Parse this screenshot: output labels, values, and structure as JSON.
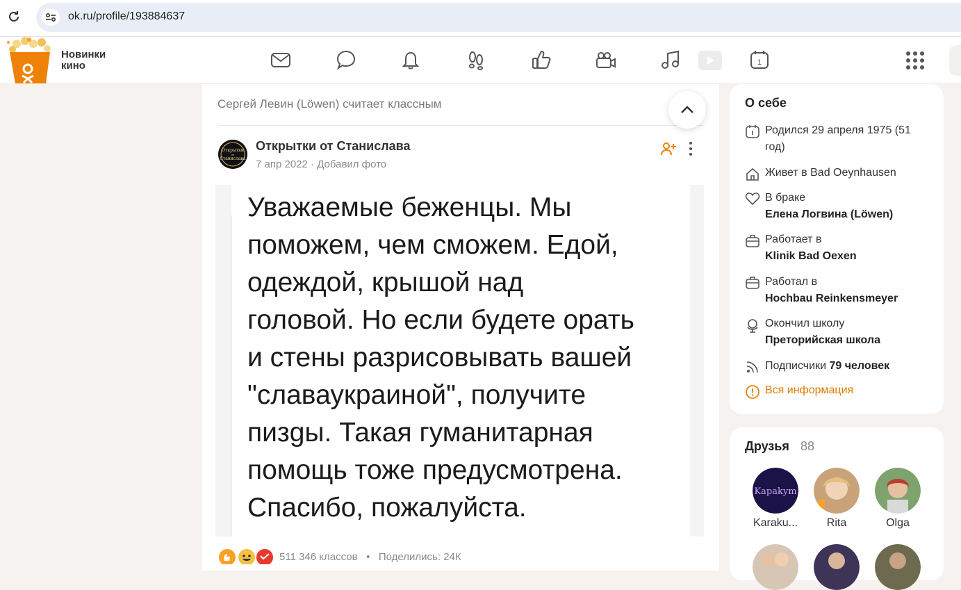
{
  "browser": {
    "url": "ok.ru/profile/193884637",
    "reload_icon": "reload-icon",
    "site_info_icon": "site-settings-icon"
  },
  "toolbar": {
    "promo_line1": "Новинки",
    "promo_line2": "кино",
    "icons": [
      "mail-icon",
      "chat-icon",
      "bell-icon",
      "footprints-icon",
      "thumbs-up-icon",
      "video-camera-icon",
      "music-icon",
      "play-icon",
      "calendar-icon",
      "apps-grid-icon"
    ],
    "calendar_day": "1"
  },
  "feed": {
    "header": "Сергей Левин (Löwen) считает классным",
    "group_name": "Открытки от Станислава",
    "avatar_text": "Открытки от Станислава",
    "post_date": "7 апр 2022",
    "post_action": "Добавил фото",
    "post_meta_sep": "·",
    "post_text": "Уважаемые беженцы. Мы\nпоможем, чем сможем. Едой,\nодеждой, крышой   над\nголовой. Но если будете орать\nи стены разрисовывать вашей\n\"славаукраиной\", получите\nпизgы. Такая гуманитарная\nпомощь тоже предусмотрена.\nСпасибо, пожалуйста.",
    "likes": "511 346 классов",
    "stats_sep": "•",
    "shares": "Поделились: 24К"
  },
  "about": {
    "title": "О себе",
    "born": "Родился 29 апреля 1975 (51 год)",
    "lives": "Живет в Bad Oeynhausen",
    "married_label": "В браке",
    "married_name": "Елена Логвина (Löwen)",
    "works_label": "Работает в",
    "works_place": "Klinik Bad Oexen",
    "worked_label": "Работал в",
    "worked_place": "Hochbau Reinkensmeyer",
    "school_label": "Окончил школу",
    "school_name": "Преторийская школа",
    "subscribers_label": "Подписчики",
    "subscribers_count": "79 человек",
    "all_info": "Вся информация",
    "accent_color": "#ee8208"
  },
  "friends": {
    "title": "Друзья",
    "count": "88",
    "items": [
      {
        "name": "Karaku...",
        "avatar_text": "Kapakym"
      },
      {
        "name": "Rita",
        "avatar_text": ""
      },
      {
        "name": "Olga",
        "avatar_text": ""
      }
    ]
  },
  "colors": {
    "brand": "#ee8208",
    "page_bg": "#f5f2ef",
    "url_bar": "#e9eef6"
  }
}
